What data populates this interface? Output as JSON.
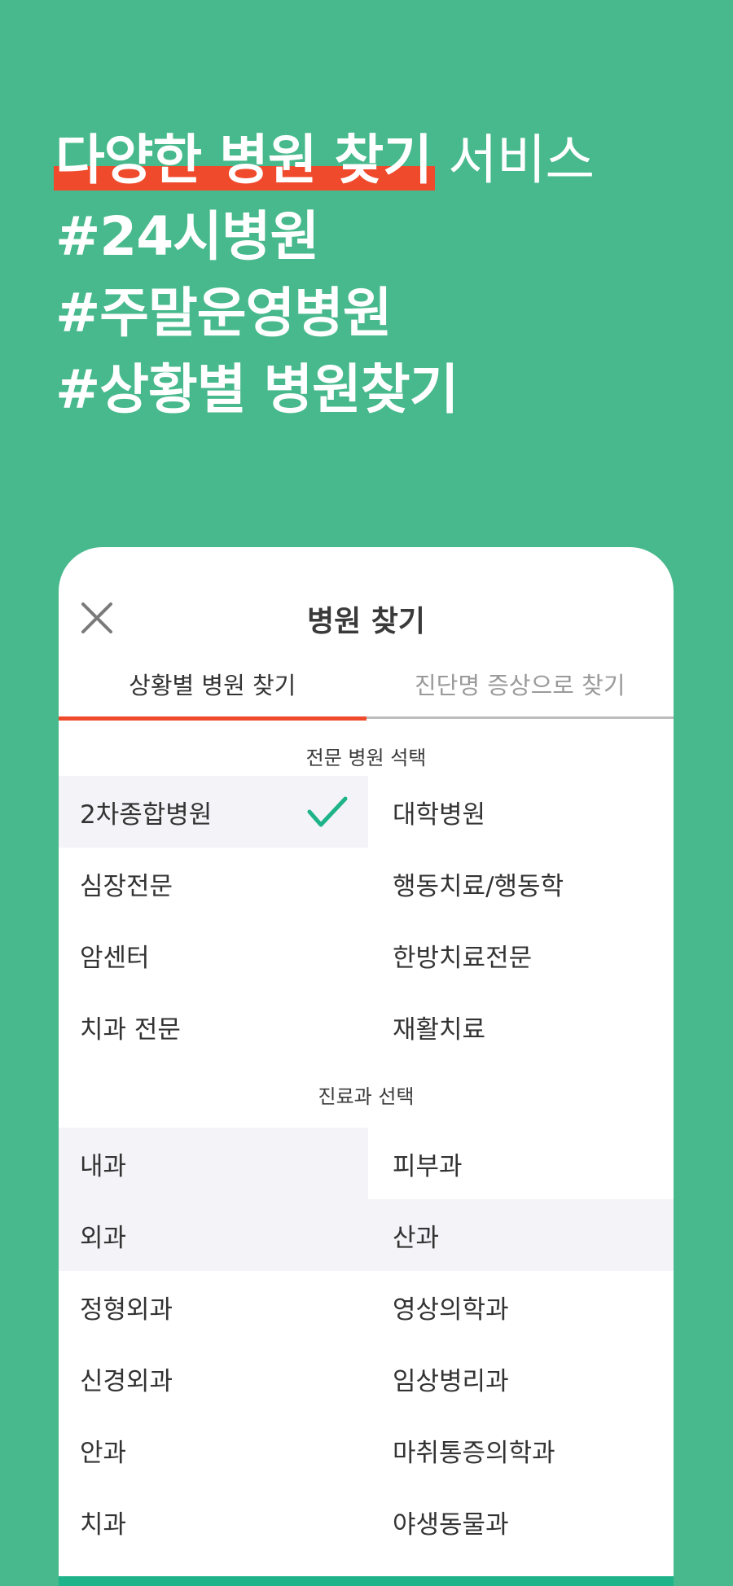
{
  "headline": {
    "highlight": "다양한 병원 찾기",
    "rest": " 서비스",
    "line2": "#24시병원",
    "line3": "#주말운영병원",
    "line4": "#상황별 병원찾기"
  },
  "colors": {
    "background": "#47b98c",
    "highlight": "#ef4a2b",
    "check": "#1fb38a",
    "selected_bg": "#f3f3f8"
  },
  "modal": {
    "title": "병원 찾기",
    "close_icon": "close-icon",
    "tabs": [
      {
        "label": "상황별 병원 찾기",
        "active": true
      },
      {
        "label": "진단명 증상으로 찾기",
        "active": false
      }
    ],
    "specialty_section": {
      "label": "전문 병원 석택",
      "items": [
        {
          "label": "2차종합병원",
          "selected": true
        },
        {
          "label": "대학병원",
          "selected": false
        },
        {
          "label": "심장전문",
          "selected": false
        },
        {
          "label": "행동치료/행동학",
          "selected": false
        },
        {
          "label": "암센터",
          "selected": false
        },
        {
          "label": "한방치료전문",
          "selected": false
        },
        {
          "label": "치과 전문",
          "selected": false
        },
        {
          "label": "재활치료",
          "selected": false
        }
      ]
    },
    "department_section": {
      "label": "진료과 선택",
      "items": [
        {
          "label": "내과",
          "selected": true
        },
        {
          "label": "피부과",
          "selected": false
        },
        {
          "label": "외과",
          "selected": true
        },
        {
          "label": "산과",
          "selected": true
        },
        {
          "label": "정형외과",
          "selected": false
        },
        {
          "label": "영상의학과",
          "selected": false
        },
        {
          "label": "신경외과",
          "selected": false
        },
        {
          "label": "임상병리과",
          "selected": false
        },
        {
          "label": "안과",
          "selected": false
        },
        {
          "label": "마취통증의학과",
          "selected": false
        },
        {
          "label": "치과",
          "selected": false
        },
        {
          "label": "야생동물과",
          "selected": false
        }
      ]
    }
  }
}
